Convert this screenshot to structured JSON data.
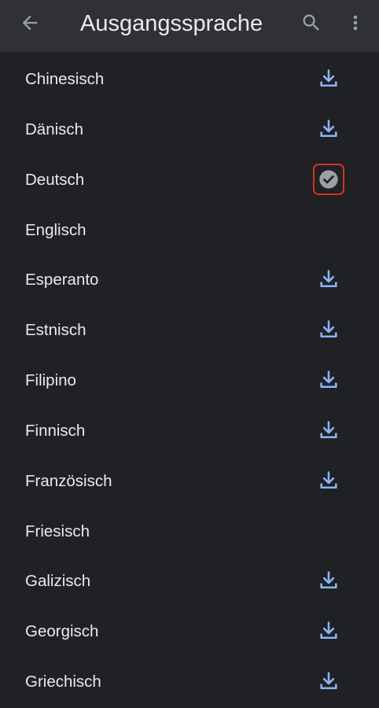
{
  "toolbar": {
    "title": "Ausgangssprache",
    "back_icon": "arrow-back-icon",
    "search_icon": "search-icon",
    "more_icon": "more-vert-icon"
  },
  "colors": {
    "background": "#202124",
    "toolbar": "#303134",
    "text": "#e8eaed",
    "download_accent": "#8ab4f8",
    "downloaded_badge": "#9aa0a6",
    "highlight_border": "#d93025"
  },
  "languages": [
    {
      "label": "Chinesisch",
      "status": "download"
    },
    {
      "label": "Dänisch",
      "status": "download"
    },
    {
      "label": "Deutsch",
      "status": "downloaded"
    },
    {
      "label": "Englisch",
      "status": "none"
    },
    {
      "label": "Esperanto",
      "status": "download"
    },
    {
      "label": "Estnisch",
      "status": "download"
    },
    {
      "label": "Filipino",
      "status": "download"
    },
    {
      "label": "Finnisch",
      "status": "download"
    },
    {
      "label": "Französisch",
      "status": "download"
    },
    {
      "label": "Friesisch",
      "status": "none"
    },
    {
      "label": "Galizisch",
      "status": "download"
    },
    {
      "label": "Georgisch",
      "status": "download"
    },
    {
      "label": "Griechisch",
      "status": "download"
    }
  ]
}
